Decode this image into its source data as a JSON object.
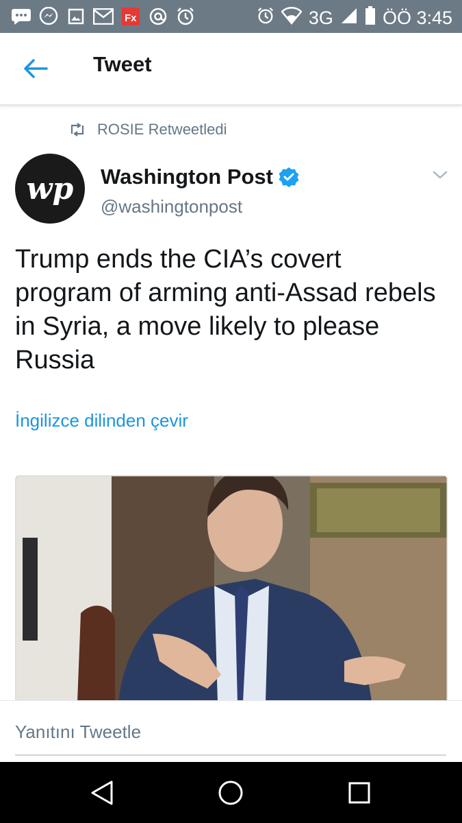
{
  "status_bar": {
    "network": "3G",
    "time": "ÖÖ 3:45",
    "left_icons": [
      "chat-icon",
      "messenger-icon",
      "image-icon",
      "gmail-icon",
      "fx-icon",
      "at-icon",
      "alarm-icon"
    ],
    "right_icons": [
      "alarm-icon",
      "wifi-icon",
      "signal-icon",
      "battery-icon"
    ]
  },
  "app_bar": {
    "title": "Tweet"
  },
  "tweet": {
    "retweet_label": "ROSIE Retweetledi",
    "author_name": "Washington Post",
    "author_handle": "@washingtonpost",
    "avatar_text": "wp",
    "verified": true,
    "text": "Trump ends the CIA’s covert program of arming anti-Assad rebels in Syria, a move likely to please Russia",
    "translate_label": "İngilizce dilinden çevir"
  },
  "reply": {
    "placeholder": "Yanıtını Tweetle"
  },
  "colors": {
    "accent": "#1b95e0",
    "status_bar": "#6c7a86",
    "text_primary": "#14171a",
    "text_secondary": "#657786"
  }
}
